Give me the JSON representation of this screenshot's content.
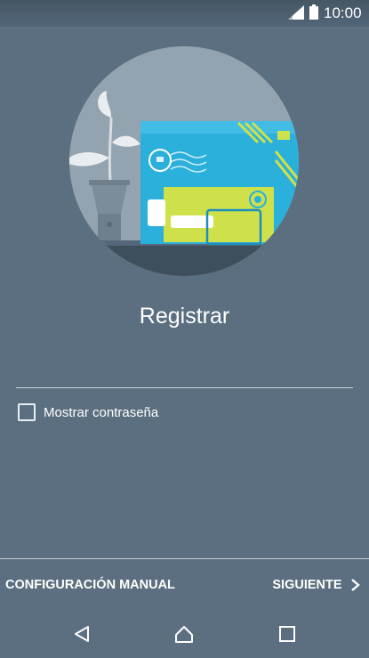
{
  "status_bar": {
    "time": "10:00",
    "signal_icon": "signal-icon",
    "battery_icon": "battery-icon"
  },
  "illustration": {
    "icon": "mail-envelope-illustration"
  },
  "main": {
    "title": "Registrar",
    "password_field": {
      "value": "",
      "placeholder": ""
    },
    "show_password": {
      "label": "Mostrar contraseña",
      "checked": false
    }
  },
  "actions": {
    "manual_label": "CONFIGURACIÓN MANUAL",
    "next_label": "SIGUIENTE",
    "next_icon": "chevron-right-icon"
  },
  "nav_bar": {
    "back_icon": "back-icon",
    "home_icon": "home-icon",
    "recents_icon": "recents-icon"
  },
  "colors": {
    "background": "#5b6f80",
    "circle": "#93a3af",
    "envelope_blue": "#2bb0dc",
    "card_yellow": "#cfe14a"
  }
}
